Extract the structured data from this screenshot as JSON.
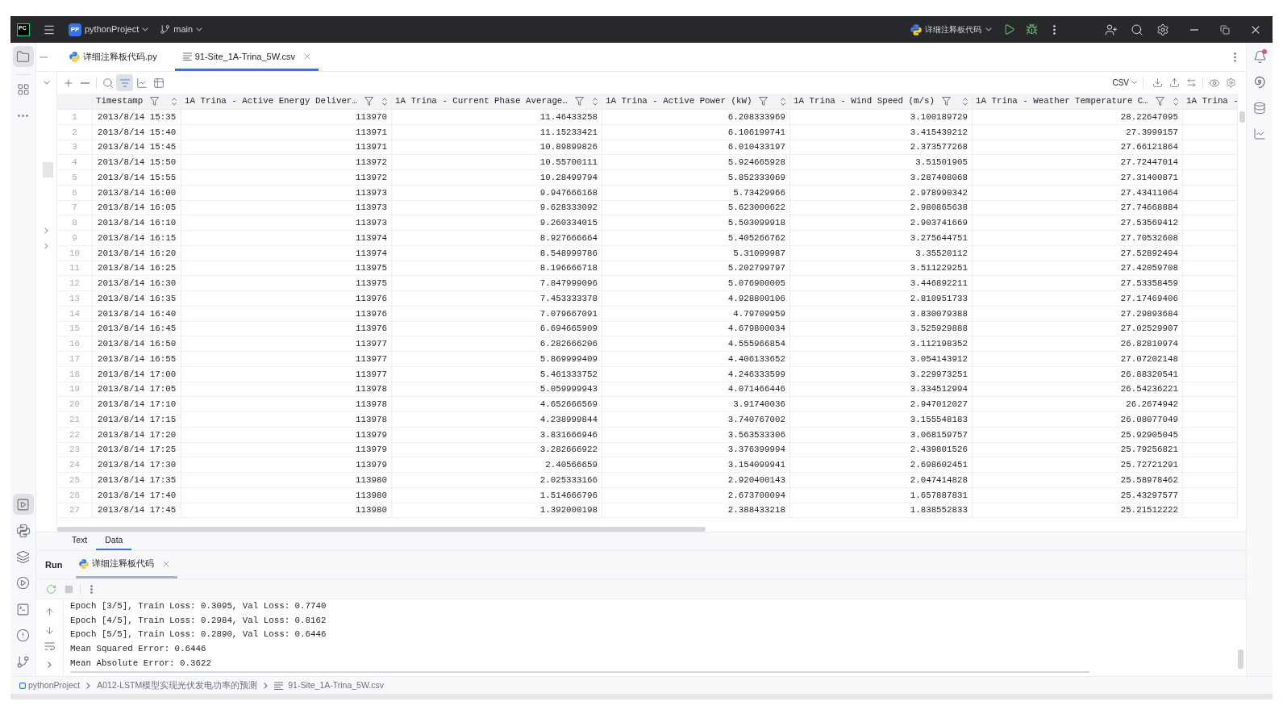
{
  "title_bar": {
    "logo": "PC",
    "project_badge": "PP",
    "project": "pythonProject",
    "branch": "main",
    "run_configuration": "详细注释板代码"
  },
  "left_toolbar": {
    "top": [
      {
        "kind": "project",
        "selected": true
      },
      {
        "kind": "structure",
        "selected": false
      },
      {
        "kind": "more",
        "selected": false
      }
    ],
    "bottom": [
      {
        "kind": "run",
        "selected": true
      },
      {
        "kind": "python_packages",
        "selected": false
      },
      {
        "kind": "layers",
        "selected": false
      },
      {
        "kind": "services",
        "selected": false
      },
      {
        "kind": "terminal",
        "selected": false
      },
      {
        "kind": "problems",
        "selected": false
      },
      {
        "kind": "git",
        "selected": false
      }
    ]
  },
  "editor_tabs": [
    {
      "kind": "python",
      "label": "详细注释板代码.py",
      "selected": false
    },
    {
      "kind": "text",
      "label": "91-Site_1A-Trina_5W.csv",
      "selected": true
    }
  ],
  "csv_toolbar": {
    "tools": [
      {
        "kind": "add",
        "selected": false
      },
      {
        "kind": "remove",
        "selected": false
      },
      {
        "kind": "search",
        "selected": false
      },
      {
        "kind": "filter_table",
        "selected": true
      },
      {
        "kind": "chart",
        "selected": false
      },
      {
        "kind": "table_settings",
        "selected": false
      }
    ],
    "format": "CSV"
  },
  "notifications": {
    "unread": true
  },
  "table": {
    "columns": [
      {
        "label": "Timestamp",
        "kind": "text"
      },
      {
        "label": "1A Trina - Active Energy Deliver…",
        "kind": "number"
      },
      {
        "label": "1A Trina - Current Phase Average…",
        "kind": "number"
      },
      {
        "label": "1A Trina - Active Power (kW)",
        "kind": "number"
      },
      {
        "label": "1A Trina - Wind Speed (m/s)",
        "kind": "number"
      },
      {
        "label": "1A Trina - Weather Temperature C…",
        "kind": "number"
      },
      {
        "label": "1A Trina -",
        "kind": "number"
      }
    ],
    "rows": [
      {
        "number": "1",
        "cells": [
          "2013/8/14 15:35",
          "113970",
          "11.46433258",
          "6.208333969",
          "3.100189729",
          "28.22647095"
        ]
      },
      {
        "number": "2",
        "cells": [
          "2013/8/14 15:40",
          "113971",
          "11.15233421",
          "6.106199741",
          "3.415439212",
          "27.3999157"
        ]
      },
      {
        "number": "3",
        "cells": [
          "2013/8/14 15:45",
          "113971",
          "10.89899826",
          "6.010433197",
          "2.373577268",
          "27.66121864"
        ]
      },
      {
        "number": "4",
        "cells": [
          "2013/8/14 15:50",
          "113972",
          "10.55700111",
          "5.924665928",
          "3.51501905",
          "27.72447014"
        ]
      },
      {
        "number": "5",
        "cells": [
          "2013/8/14 15:55",
          "113972",
          "10.28499794",
          "5.852333069",
          "3.287408068",
          "27.31400871"
        ]
      },
      {
        "number": "6",
        "cells": [
          "2013/8/14 16:00",
          "113973",
          "9.947666168",
          "5.73429966",
          "2.978990342",
          "27.43411064"
        ]
      },
      {
        "number": "7",
        "cells": [
          "2013/8/14 16:05",
          "113973",
          "9.628333092",
          "5.623000622",
          "2.980865638",
          "27.74668884"
        ]
      },
      {
        "number": "8",
        "cells": [
          "2013/8/14 16:10",
          "113973",
          "9.260334015",
          "5.503099918",
          "2.903741669",
          "27.53569412"
        ]
      },
      {
        "number": "9",
        "cells": [
          "2013/8/14 16:15",
          "113974",
          "8.927666664",
          "5.405266762",
          "3.275644751",
          "27.70532608"
        ]
      },
      {
        "number": "10",
        "cells": [
          "2013/8/14 16:20",
          "113974",
          "8.548999786",
          "5.31099987",
          "3.35520112",
          "27.52892494"
        ]
      },
      {
        "number": "11",
        "cells": [
          "2013/8/14 16:25",
          "113975",
          "8.196666718",
          "5.202799797",
          "3.511229251",
          "27.42059708"
        ]
      },
      {
        "number": "12",
        "cells": [
          "2013/8/14 16:30",
          "113975",
          "7.847999096",
          "5.076900005",
          "3.446892211",
          "27.53358459"
        ]
      },
      {
        "number": "13",
        "cells": [
          "2013/8/14 16:35",
          "113976",
          "7.453333378",
          "4.928800106",
          "2.810951733",
          "27.17469406"
        ]
      },
      {
        "number": "14",
        "cells": [
          "2013/8/14 16:40",
          "113976",
          "7.079667091",
          "4.79709959",
          "3.830079388",
          "27.29893684"
        ]
      },
      {
        "number": "15",
        "cells": [
          "2013/8/14 16:45",
          "113976",
          "6.694665909",
          "4.679800034",
          "3.525929888",
          "27.02529907"
        ]
      },
      {
        "number": "16",
        "cells": [
          "2013/8/14 16:50",
          "113977",
          "6.282666206",
          "4.555966854",
          "3.112198352",
          "26.82810974"
        ]
      },
      {
        "number": "17",
        "cells": [
          "2013/8/14 16:55",
          "113977",
          "5.869999409",
          "4.406133652",
          "3.054143912",
          "27.07202148"
        ]
      },
      {
        "number": "18",
        "cells": [
          "2013/8/14 17:00",
          "113977",
          "5.461333752",
          "4.246333599",
          "3.229973251",
          "26.88320541"
        ]
      },
      {
        "number": "19",
        "cells": [
          "2013/8/14 17:05",
          "113978",
          "5.059999943",
          "4.071466446",
          "3.334512994",
          "26.54236221"
        ]
      },
      {
        "number": "20",
        "cells": [
          "2013/8/14 17:10",
          "113978",
          "4.652666569",
          "3.91740036",
          "2.947012027",
          "26.2674942"
        ]
      },
      {
        "number": "21",
        "cells": [
          "2013/8/14 17:15",
          "113978",
          "4.238999844",
          "3.740767002",
          "3.155548183",
          "26.08077049"
        ]
      },
      {
        "number": "22",
        "cells": [
          "2013/8/14 17:20",
          "113979",
          "3.831666946",
          "3.563533306",
          "3.068159757",
          "25.92905045"
        ]
      },
      {
        "number": "23",
        "cells": [
          "2013/8/14 17:25",
          "113979",
          "3.282666922",
          "3.376399994",
          "2.439801526",
          "25.79256821"
        ]
      },
      {
        "number": "24",
        "cells": [
          "2013/8/14 17:30",
          "113979",
          "2.40566659",
          "3.154099941",
          "2.698602451",
          "25.72721291"
        ]
      },
      {
        "number": "25",
        "cells": [
          "2013/8/14 17:35",
          "113980",
          "2.025333166",
          "2.920400143",
          "2.047414828",
          "25.58978462"
        ]
      },
      {
        "number": "26",
        "cells": [
          "2013/8/14 17:40",
          "113980",
          "1.514666796",
          "2.673700094",
          "1.657887831",
          "25.43297577"
        ]
      },
      {
        "number": "27",
        "cells": [
          "2013/8/14 17:45",
          "113980",
          "1.392000198",
          "2.388433218",
          "1.838552833",
          "25.21512222"
        ]
      }
    ]
  },
  "view_tabs": [
    {
      "label": "Text",
      "selected": false
    },
    {
      "label": "Data",
      "selected": true
    }
  ],
  "run_panel": {
    "title": "Run",
    "tabs": [
      {
        "label": "详细注释板代码",
        "selected": true
      }
    ],
    "output": [
      "Epoch [3/5], Train Loss: 0.3095, Val Loss: 0.7740",
      "Epoch [4/5], Train Loss: 0.2984, Val Loss: 0.8162",
      "Epoch [5/5], Train Loss: 0.2890, Val Loss: 0.6446",
      "Mean Squared Error: 0.6446",
      "Mean Absolute Error: 0.3622"
    ]
  },
  "breadcrumbs": [
    {
      "kind": "module",
      "label": "pythonProject"
    },
    {
      "kind": "folder",
      "label": "A012-LSTM模型实现光伏发电功率的预测"
    },
    {
      "kind": "file",
      "label": "91-Site_1A-Trina_5W.csv"
    }
  ]
}
